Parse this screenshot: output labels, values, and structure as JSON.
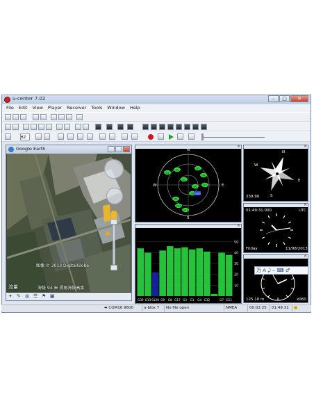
{
  "window": {
    "title": "u-center 7.02"
  },
  "menu": [
    "File",
    "Edit",
    "View",
    "Player",
    "Receiver",
    "Tools",
    "Window",
    "Help"
  ],
  "toolbar": {
    "baud_value": "BZ"
  },
  "google_earth": {
    "title": "Google Earth",
    "caption_year": "图像 © 2013 DigitalGlobe",
    "caption_bottom": "海拔 94 米 视角海拔高度",
    "caption_left": "流量",
    "status_icons": [
      "pin-icon",
      "edit-icon",
      "globe-icon",
      "list-icon",
      "flag-icon",
      "save-icon"
    ]
  },
  "skyview": {
    "labels": [
      "N",
      "E",
      "S",
      "W"
    ],
    "satellites": [
      "G1",
      "G2",
      "G3",
      "G4",
      "G5",
      "G6",
      "G7",
      "G8",
      "G9",
      "G10",
      "G11"
    ],
    "sbas_label": "S120"
  },
  "levels": {
    "y_ticks": [
      "50",
      "40",
      "30",
      "20",
      "10"
    ],
    "bar_values": [
      44,
      40,
      22,
      42,
      46,
      44,
      45,
      43,
      44,
      41,
      2,
      40,
      38
    ],
    "bar_colors": [
      "#27c23b",
      "#27c23b",
      "#12219d",
      "#27c23b",
      "#27c23b",
      "#27c23b",
      "#27c23b",
      "#27c23b",
      "#27c23b",
      "#27c23b",
      "#27c23b",
      "#27c23b",
      "#27c23b"
    ],
    "sat_labels": [
      "G30",
      "G13",
      "S120",
      "G9",
      "G8",
      "G17",
      "G3",
      "G1",
      "G4",
      "G32",
      "",
      "G7",
      "G11"
    ]
  },
  "compass": {
    "labels": [
      "N",
      "E",
      "S",
      "W"
    ],
    "speed": "239.90"
  },
  "clock": {
    "time": "01:49:31.000",
    "zone": "UTC",
    "day": "Friday",
    "date": "11/08/2013"
  },
  "clock2": {
    "value": "125.10 m",
    "unit": "x060"
  },
  "ime": {
    "text": "万 A ⤸ ⌣ ⌨ ♂"
  },
  "status": {
    "port": "COM16 9600",
    "receiver": "u-blox 7",
    "file": "No file open",
    "protocol": "NMEA",
    "elapsed": "00:02:25",
    "clock": "01:49:31"
  }
}
